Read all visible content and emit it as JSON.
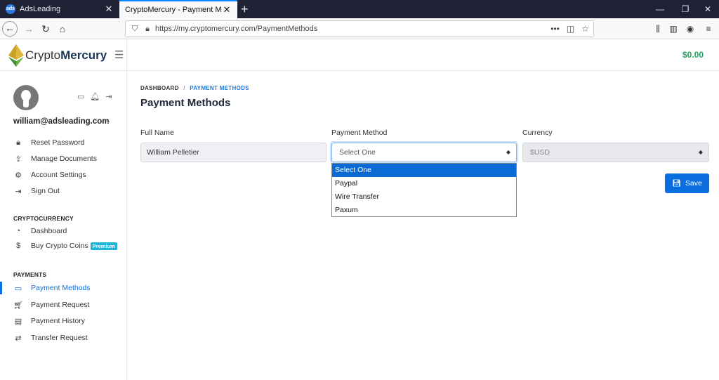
{
  "browser": {
    "tabs": [
      {
        "label": "AdsLeading",
        "favicon": "ads"
      },
      {
        "label": "CryptoMercury - Payment Methods"
      }
    ],
    "url": "https://my.cryptomercury.com/PaymentMethods"
  },
  "app": {
    "brand_light": "Crypto",
    "brand_bold": "Mercury",
    "balance": "$0.00"
  },
  "user": {
    "email": "william@adsleading.com"
  },
  "sidebar": {
    "account_items": [
      {
        "label": "Reset Password"
      },
      {
        "label": "Manage Documents"
      },
      {
        "label": "Account Settings"
      },
      {
        "label": "Sign Out"
      }
    ],
    "crypto_heading": "CRYPTOCURRENCY",
    "crypto_items": [
      {
        "label": "Dashboard"
      },
      {
        "label": "Buy Crypto Coins",
        "badge": "Premium"
      }
    ],
    "payments_heading": "PAYMENTS",
    "payments_items": [
      {
        "label": "Payment Methods"
      },
      {
        "label": "Payment Request"
      },
      {
        "label": "Payment History"
      },
      {
        "label": "Transfer Request"
      }
    ]
  },
  "main": {
    "breadcrumb": [
      "DASHBOARD",
      "PAYMENT METHODS"
    ],
    "title": "Payment Methods",
    "fields": {
      "full_name_label": "Full Name",
      "full_name_value": "William Pelletier",
      "method_label": "Payment Method",
      "method_value": "Select One",
      "method_options": [
        "Select One",
        "Paypal",
        "Wire Transfer",
        "Paxum"
      ],
      "currency_label": "Currency",
      "currency_value": "$USD"
    },
    "save_label": "Save"
  },
  "colors": {
    "accent": "#0a6ee0",
    "balance": "#21a35b",
    "badge": "#1cb4d8",
    "tabbar": "#1f2135"
  }
}
